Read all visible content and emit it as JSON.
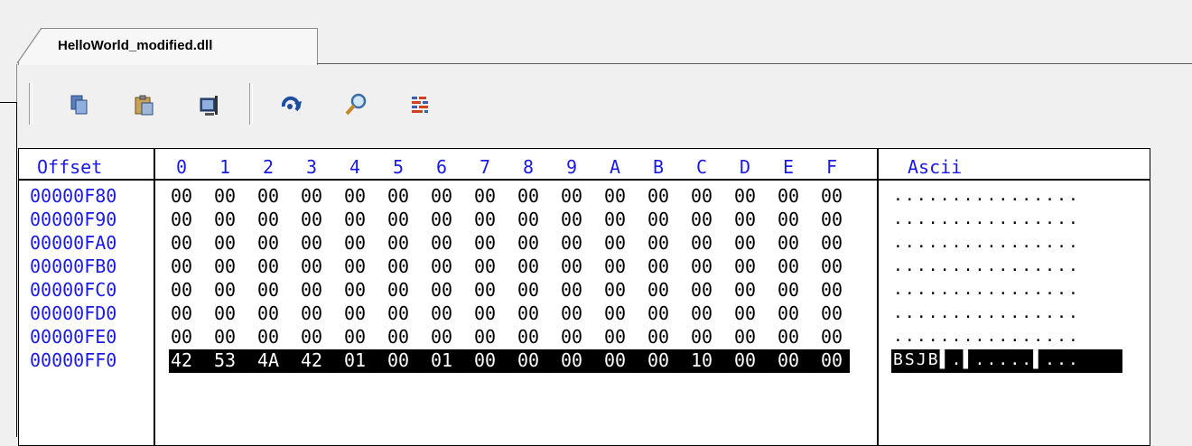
{
  "tab": {
    "title": "HelloWorld_modified.dll"
  },
  "toolbar": {
    "buttons": [
      {
        "name": "copy",
        "icon": "copy-icon"
      },
      {
        "name": "paste",
        "icon": "paste-icon"
      },
      {
        "name": "insert",
        "icon": "insert-icon"
      },
      {
        "name": "refresh",
        "icon": "refresh-icon"
      },
      {
        "name": "find",
        "icon": "search-icon"
      },
      {
        "name": "settings",
        "icon": "hex-options-icon"
      }
    ]
  },
  "hexview": {
    "offset_header": "Offset",
    "ascii_header": "Ascii",
    "columns": [
      "0",
      "1",
      "2",
      "3",
      "4",
      "5",
      "6",
      "7",
      "8",
      "9",
      "A",
      "B",
      "C",
      "D",
      "E",
      "F"
    ],
    "rows": [
      {
        "offset": "00000F80",
        "bytes": [
          "00",
          "00",
          "00",
          "00",
          "00",
          "00",
          "00",
          "00",
          "00",
          "00",
          "00",
          "00",
          "00",
          "00",
          "00",
          "00"
        ],
        "ascii": "................"
      },
      {
        "offset": "00000F90",
        "bytes": [
          "00",
          "00",
          "00",
          "00",
          "00",
          "00",
          "00",
          "00",
          "00",
          "00",
          "00",
          "00",
          "00",
          "00",
          "00",
          "00"
        ],
        "ascii": "................"
      },
      {
        "offset": "00000FA0",
        "bytes": [
          "00",
          "00",
          "00",
          "00",
          "00",
          "00",
          "00",
          "00",
          "00",
          "00",
          "00",
          "00",
          "00",
          "00",
          "00",
          "00"
        ],
        "ascii": "................"
      },
      {
        "offset": "00000FB0",
        "bytes": [
          "00",
          "00",
          "00",
          "00",
          "00",
          "00",
          "00",
          "00",
          "00",
          "00",
          "00",
          "00",
          "00",
          "00",
          "00",
          "00"
        ],
        "ascii": "................"
      },
      {
        "offset": "00000FC0",
        "bytes": [
          "00",
          "00",
          "00",
          "00",
          "00",
          "00",
          "00",
          "00",
          "00",
          "00",
          "00",
          "00",
          "00",
          "00",
          "00",
          "00"
        ],
        "ascii": "................"
      },
      {
        "offset": "00000FD0",
        "bytes": [
          "00",
          "00",
          "00",
          "00",
          "00",
          "00",
          "00",
          "00",
          "00",
          "00",
          "00",
          "00",
          "00",
          "00",
          "00",
          "00"
        ],
        "ascii": "................"
      },
      {
        "offset": "00000FE0",
        "bytes": [
          "00",
          "00",
          "00",
          "00",
          "00",
          "00",
          "00",
          "00",
          "00",
          "00",
          "00",
          "00",
          "00",
          "00",
          "00",
          "00"
        ],
        "ascii": "................"
      },
      {
        "offset": "00000FF0",
        "bytes": [
          "42",
          "53",
          "4A",
          "42",
          "01",
          "00",
          "01",
          "00",
          "00",
          "00",
          "00",
          "00",
          "10",
          "00",
          "00",
          "00"
        ],
        "ascii": "BSJB▌.▌.....▌...",
        "selected": true
      }
    ]
  },
  "colors": {
    "offset_text": "#1a1ae6",
    "selection_bg": "#000000",
    "selection_text": "#ffffff"
  }
}
